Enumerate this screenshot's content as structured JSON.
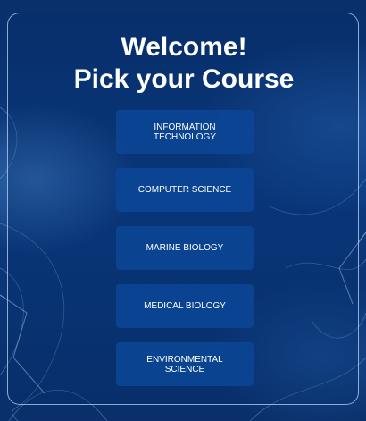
{
  "title": {
    "line1": "Welcome!",
    "line2": "Pick your Course"
  },
  "courses": [
    {
      "label": "INFORMATION TECHNOLOGY"
    },
    {
      "label": "COMPUTER SCIENCE"
    },
    {
      "label": "MARINE BIOLOGY"
    },
    {
      "label": "MEDICAL BIOLOGY"
    },
    {
      "label": "ENVIRONMENTAL SCIENCE"
    }
  ],
  "colors": {
    "background": "#0b3a80",
    "button": "#0a4696",
    "text": "#ffffff",
    "panel_border": "#bed7f5"
  }
}
